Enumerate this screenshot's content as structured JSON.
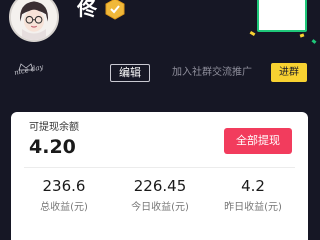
{
  "profile": {
    "username": "佟",
    "badge_text": "nice day",
    "level_badge_color": "#f0b83a"
  },
  "actions": {
    "edit_label": "编辑",
    "join_community_text": "加入社群交流推广",
    "join_label": "进群"
  },
  "earnings": {
    "balance_label": "可提现余额",
    "balance_value": "4.20",
    "withdraw_label": "全部提现",
    "stats": [
      {
        "value": "236.6",
        "label": "总收益(元)"
      },
      {
        "value": "226.45",
        "label": "今日收益(元)"
      },
      {
        "value": "4.2",
        "label": "昨日收益(元)"
      }
    ]
  },
  "colors": {
    "background": "#161725",
    "withdraw_button": "#f23c5d",
    "join_button": "#f8d231",
    "promo_border": "#1fc87a"
  }
}
